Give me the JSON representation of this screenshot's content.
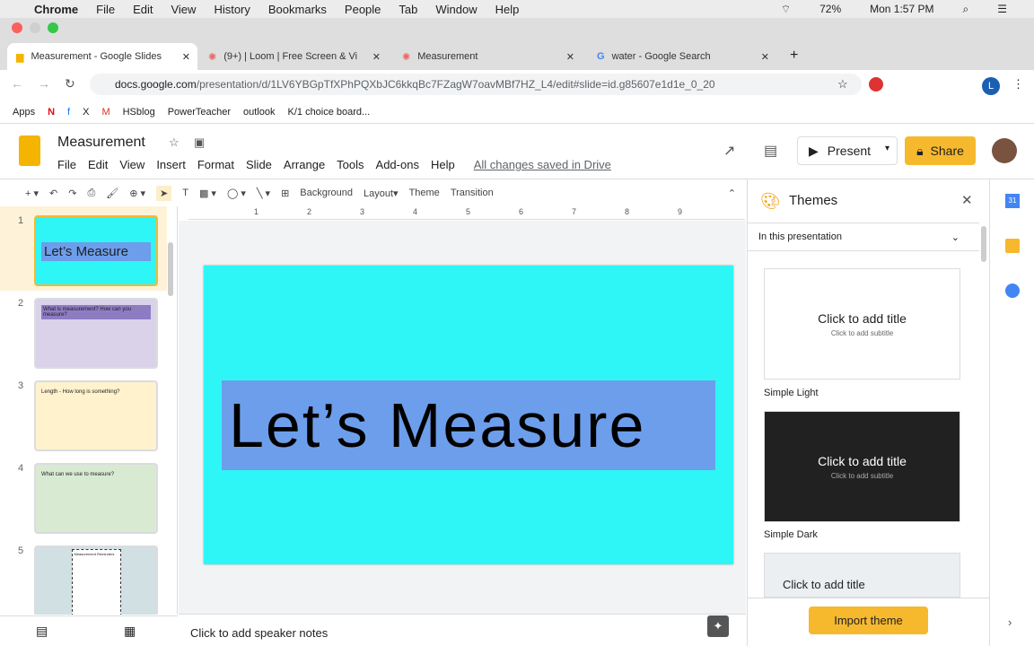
{
  "mac": {
    "menu": [
      "Chrome",
      "File",
      "Edit",
      "View",
      "History",
      "Bookmarks",
      "People",
      "Tab",
      "Window",
      "Help"
    ],
    "battery": "72%",
    "time": "Mon 1:57 PM"
  },
  "tabs": [
    {
      "label": "Measurement - Google Slides"
    },
    {
      "label": "(9+) | Loom | Free Screen & Vi"
    },
    {
      "label": "Measurement"
    },
    {
      "label": "water - Google Search"
    }
  ],
  "url": {
    "domain": "docs.google.com",
    "path": "/presentation/d/1LV6YBGpTfXPhPQXbJC6kkqBc7FZagW7oavMBf7HZ_L4/edit#slide=id.g85607e1d1e_0_20"
  },
  "bookmarks": [
    "Apps",
    "HSblog",
    "PowerTeacher",
    "outlook",
    "K/1 choice board..."
  ],
  "doc": {
    "title": "Measurement",
    "menu": [
      "File",
      "Edit",
      "View",
      "Insert",
      "Format",
      "Slide",
      "Arrange",
      "Tools",
      "Add-ons",
      "Help"
    ],
    "saved": "All changes saved in Drive",
    "present": "Present",
    "share": "Share"
  },
  "toolbar": {
    "background": "Background",
    "layout": "Layout",
    "theme": "Theme",
    "transition": "Transition"
  },
  "ruler": [
    "1",
    "2",
    "3",
    "4",
    "5",
    "6",
    "7",
    "8",
    "9"
  ],
  "slides": [
    {
      "n": "1",
      "text": "Let’s Measure"
    },
    {
      "n": "2",
      "text": "What is measurement? How can you measure?"
    },
    {
      "n": "3",
      "text": "Length - How long is something?"
    },
    {
      "n": "4",
      "text": "What can we use to measure?"
    },
    {
      "n": "5",
      "text": "Measurement Reminders"
    }
  ],
  "slide_title": "Let’s Measure",
  "notes": "Click to add speaker notes",
  "themes": {
    "title": "Themes",
    "filter": "In this presentation",
    "items": [
      {
        "name": "Simple Light",
        "title": "Click to add title",
        "subtitle": "Click to add subtitle"
      },
      {
        "name": "Simple Dark",
        "title": "Click to add title",
        "subtitle": "Click to add subtitle"
      },
      {
        "title": "Click to add title"
      }
    ],
    "import": "Import theme"
  }
}
